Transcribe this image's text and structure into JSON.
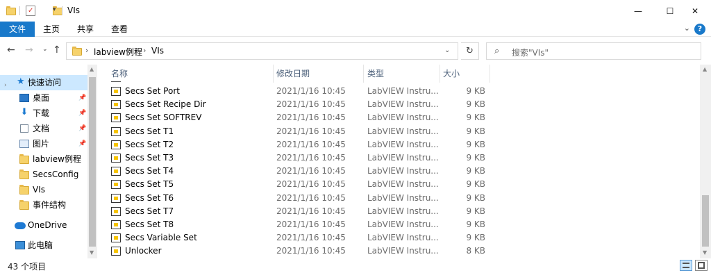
{
  "window": {
    "title": "VIs",
    "controls": {
      "minimize": "—",
      "maximize": "☐",
      "close": "✕"
    }
  },
  "ribbon": {
    "tabs": [
      "文件",
      "主页",
      "共享",
      "查看"
    ],
    "help": "?"
  },
  "address": {
    "crumbs": [
      "labview例程",
      "VIs"
    ],
    "search_placeholder": "搜索\"VIs\""
  },
  "sidebar": {
    "items": [
      {
        "label": "快速访问",
        "icon": "star-icon",
        "pinned": false,
        "active": true
      },
      {
        "label": "桌面",
        "icon": "desktop-icon",
        "pinned": true
      },
      {
        "label": "下载",
        "icon": "download-icon",
        "pinned": true
      },
      {
        "label": "文档",
        "icon": "document-icon",
        "pinned": true
      },
      {
        "label": "图片",
        "icon": "picture-icon",
        "pinned": true
      },
      {
        "label": "labview例程",
        "icon": "folder-icon",
        "pinned": false
      },
      {
        "label": "SecsConfig",
        "icon": "folder-icon",
        "pinned": false
      },
      {
        "label": "VIs",
        "icon": "folder-icon",
        "pinned": false
      },
      {
        "label": "事件结构",
        "icon": "folder-icon",
        "pinned": false
      },
      {
        "label": "OneDrive",
        "icon": "onedrive-icon",
        "pinned": false
      },
      {
        "label": "此电脑",
        "icon": "pc-icon",
        "pinned": false
      }
    ]
  },
  "columns": {
    "name": "名称",
    "date": "修改日期",
    "type": "类型",
    "size": "大小"
  },
  "files": [
    {
      "name": "Secs Set Port",
      "date": "2021/1/16 10:45",
      "type": "LabVIEW Instru...",
      "size": "9 KB"
    },
    {
      "name": "Secs Set Recipe Dir",
      "date": "2021/1/16 10:45",
      "type": "LabVIEW Instru...",
      "size": "9 KB"
    },
    {
      "name": "Secs Set SOFTREV",
      "date": "2021/1/16 10:45",
      "type": "LabVIEW Instru...",
      "size": "9 KB"
    },
    {
      "name": "Secs Set T1",
      "date": "2021/1/16 10:45",
      "type": "LabVIEW Instru...",
      "size": "9 KB"
    },
    {
      "name": "Secs Set T2",
      "date": "2021/1/16 10:45",
      "type": "LabVIEW Instru...",
      "size": "9 KB"
    },
    {
      "name": "Secs Set T3",
      "date": "2021/1/16 10:45",
      "type": "LabVIEW Instru...",
      "size": "9 KB"
    },
    {
      "name": "Secs Set T4",
      "date": "2021/1/16 10:45",
      "type": "LabVIEW Instru...",
      "size": "9 KB"
    },
    {
      "name": "Secs Set T5",
      "date": "2021/1/16 10:45",
      "type": "LabVIEW Instru...",
      "size": "9 KB"
    },
    {
      "name": "Secs Set T6",
      "date": "2021/1/16 10:45",
      "type": "LabVIEW Instru...",
      "size": "9 KB"
    },
    {
      "name": "Secs Set T7",
      "date": "2021/1/16 10:45",
      "type": "LabVIEW Instru...",
      "size": "9 KB"
    },
    {
      "name": "Secs Set T8",
      "date": "2021/1/16 10:45",
      "type": "LabVIEW Instru...",
      "size": "9 KB"
    },
    {
      "name": "Secs Variable Set",
      "date": "2021/1/16 10:45",
      "type": "LabVIEW Instru...",
      "size": "9 KB"
    },
    {
      "name": "Unlocker",
      "date": "2021/1/16 10:45",
      "type": "LabVIEW Instru...",
      "size": "8 KB"
    }
  ],
  "status": {
    "count": "43 个项目"
  },
  "colors": {
    "accent": "#1979ca",
    "selection": "#cce8ff",
    "header_text": "#4c607a"
  }
}
